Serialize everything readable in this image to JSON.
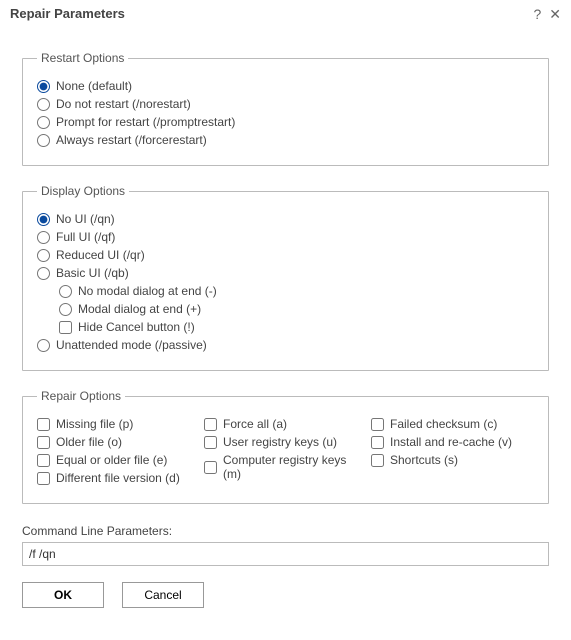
{
  "dialog": {
    "title": "Repair Parameters"
  },
  "restart": {
    "legend": "Restart Options",
    "options": {
      "none": "None (default)",
      "norestart": "Do not restart (/norestart)",
      "prompt": "Prompt for restart (/promptrestart)",
      "force": "Always restart (/forcerestart)"
    },
    "selected": "none"
  },
  "display": {
    "legend": "Display Options",
    "options": {
      "noui": "No UI (/qn)",
      "fullui": "Full UI (/qf)",
      "reducedui": "Reduced UI (/qr)",
      "basicui": "Basic UI (/qb)",
      "basic_nomodal": "No modal dialog at end (-)",
      "basic_modal": "Modal dialog at end (+)",
      "basic_hidecancel": "Hide Cancel button (!)",
      "passive": "Unattended mode (/passive)"
    },
    "selected": "noui"
  },
  "repair": {
    "legend": "Repair Options",
    "col1": {
      "missing": "Missing file (p)",
      "older": "Older file (o)",
      "equal": "Equal or older file (e)",
      "diff": "Different file version (d)"
    },
    "col2": {
      "forceall": "Force all (a)",
      "userreg": "User registry keys (u)",
      "compreg": "Computer registry keys (m)"
    },
    "col3": {
      "checksum": "Failed checksum (c)",
      "recache": "Install and re-cache (v)",
      "shortcuts": "Shortcuts (s)"
    }
  },
  "command": {
    "label": "Command Line Parameters:",
    "value": "/f /qn"
  },
  "buttons": {
    "ok": "OK",
    "cancel": "Cancel"
  }
}
